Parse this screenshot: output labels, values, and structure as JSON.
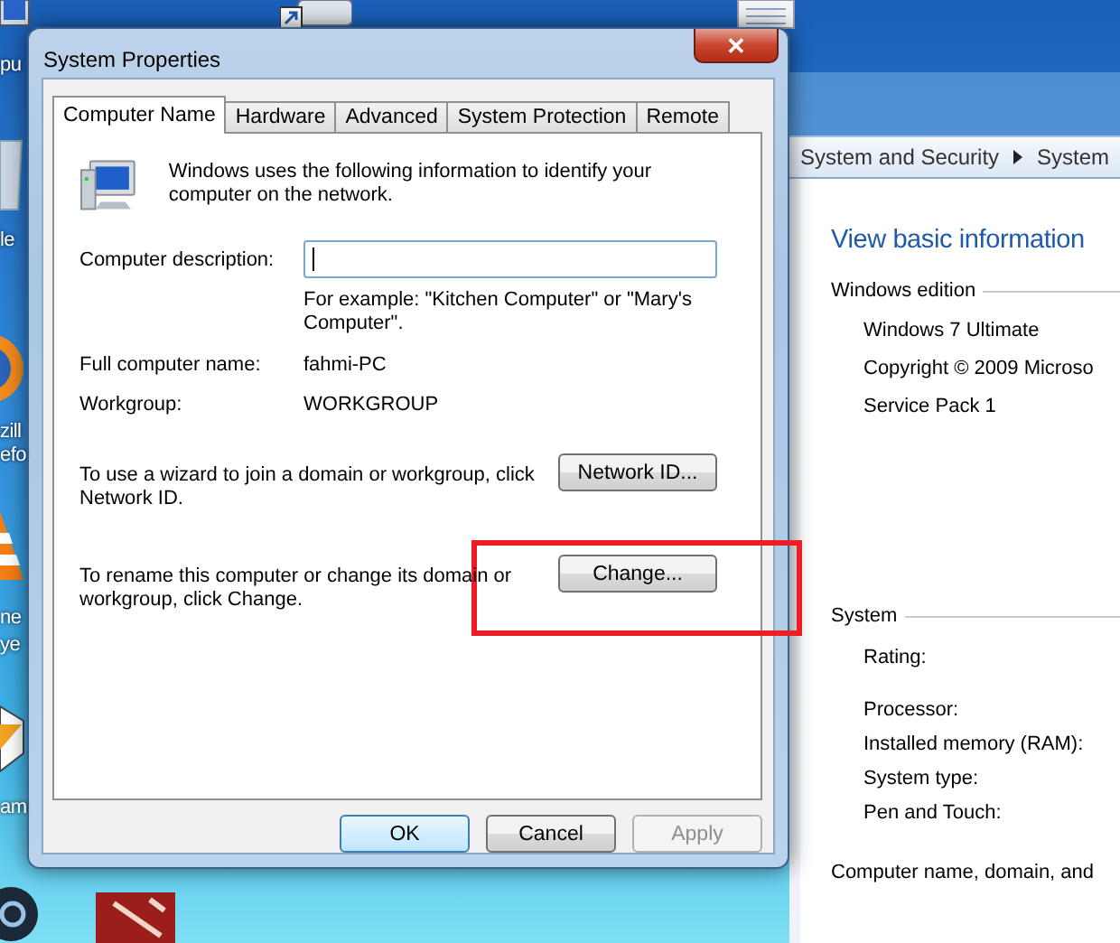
{
  "desktop": {
    "icon_labels": [
      "pu",
      "le",
      "zill",
      "efo",
      "ne",
      "ye",
      "am"
    ]
  },
  "system_window": {
    "breadcrumb": [
      "System and Security",
      "System"
    ],
    "heading": "View basic information",
    "sections": [
      {
        "title": "Windows edition",
        "items": [
          "Windows 7 Ultimate",
          "Copyright © 2009 Microso",
          "Service Pack 1"
        ]
      },
      {
        "title": "System",
        "items": [
          "Rating:",
          "Processor:",
          "Installed memory (RAM):",
          "System type:",
          "Pen and Touch:"
        ]
      }
    ],
    "footer": "Computer name, domain, and"
  },
  "dialog": {
    "title": "System Properties",
    "close": "✕",
    "tabs": [
      {
        "label": "Computer Name",
        "selected": true
      },
      {
        "label": "Hardware",
        "selected": false
      },
      {
        "label": "Advanced",
        "selected": false
      },
      {
        "label": "System Protection",
        "selected": false
      },
      {
        "label": "Remote",
        "selected": false
      }
    ],
    "intro": "Windows uses the following information to identify your computer on the network.",
    "description": {
      "label": "Computer description:",
      "hint": "For example: \"Kitchen Computer\" or \"Mary's Computer\"."
    },
    "info": [
      {
        "label": "Full computer name:",
        "value": "fahmi-PC"
      },
      {
        "label": "Workgroup:",
        "value": "WORKGROUP"
      }
    ],
    "actions": [
      {
        "text": "To use a wizard to join a domain or workgroup, click Network ID.",
        "button": "Network ID...",
        "highlighted": false
      },
      {
        "text": "To rename this computer or change its domain or workgroup, click Change.",
        "button": "Change...",
        "highlighted": true
      }
    ],
    "buttons": [
      {
        "label": "OK",
        "default": true,
        "disabled": false
      },
      {
        "label": "Cancel",
        "default": false,
        "disabled": false
      },
      {
        "label": "Apply",
        "default": false,
        "disabled": true
      }
    ]
  }
}
